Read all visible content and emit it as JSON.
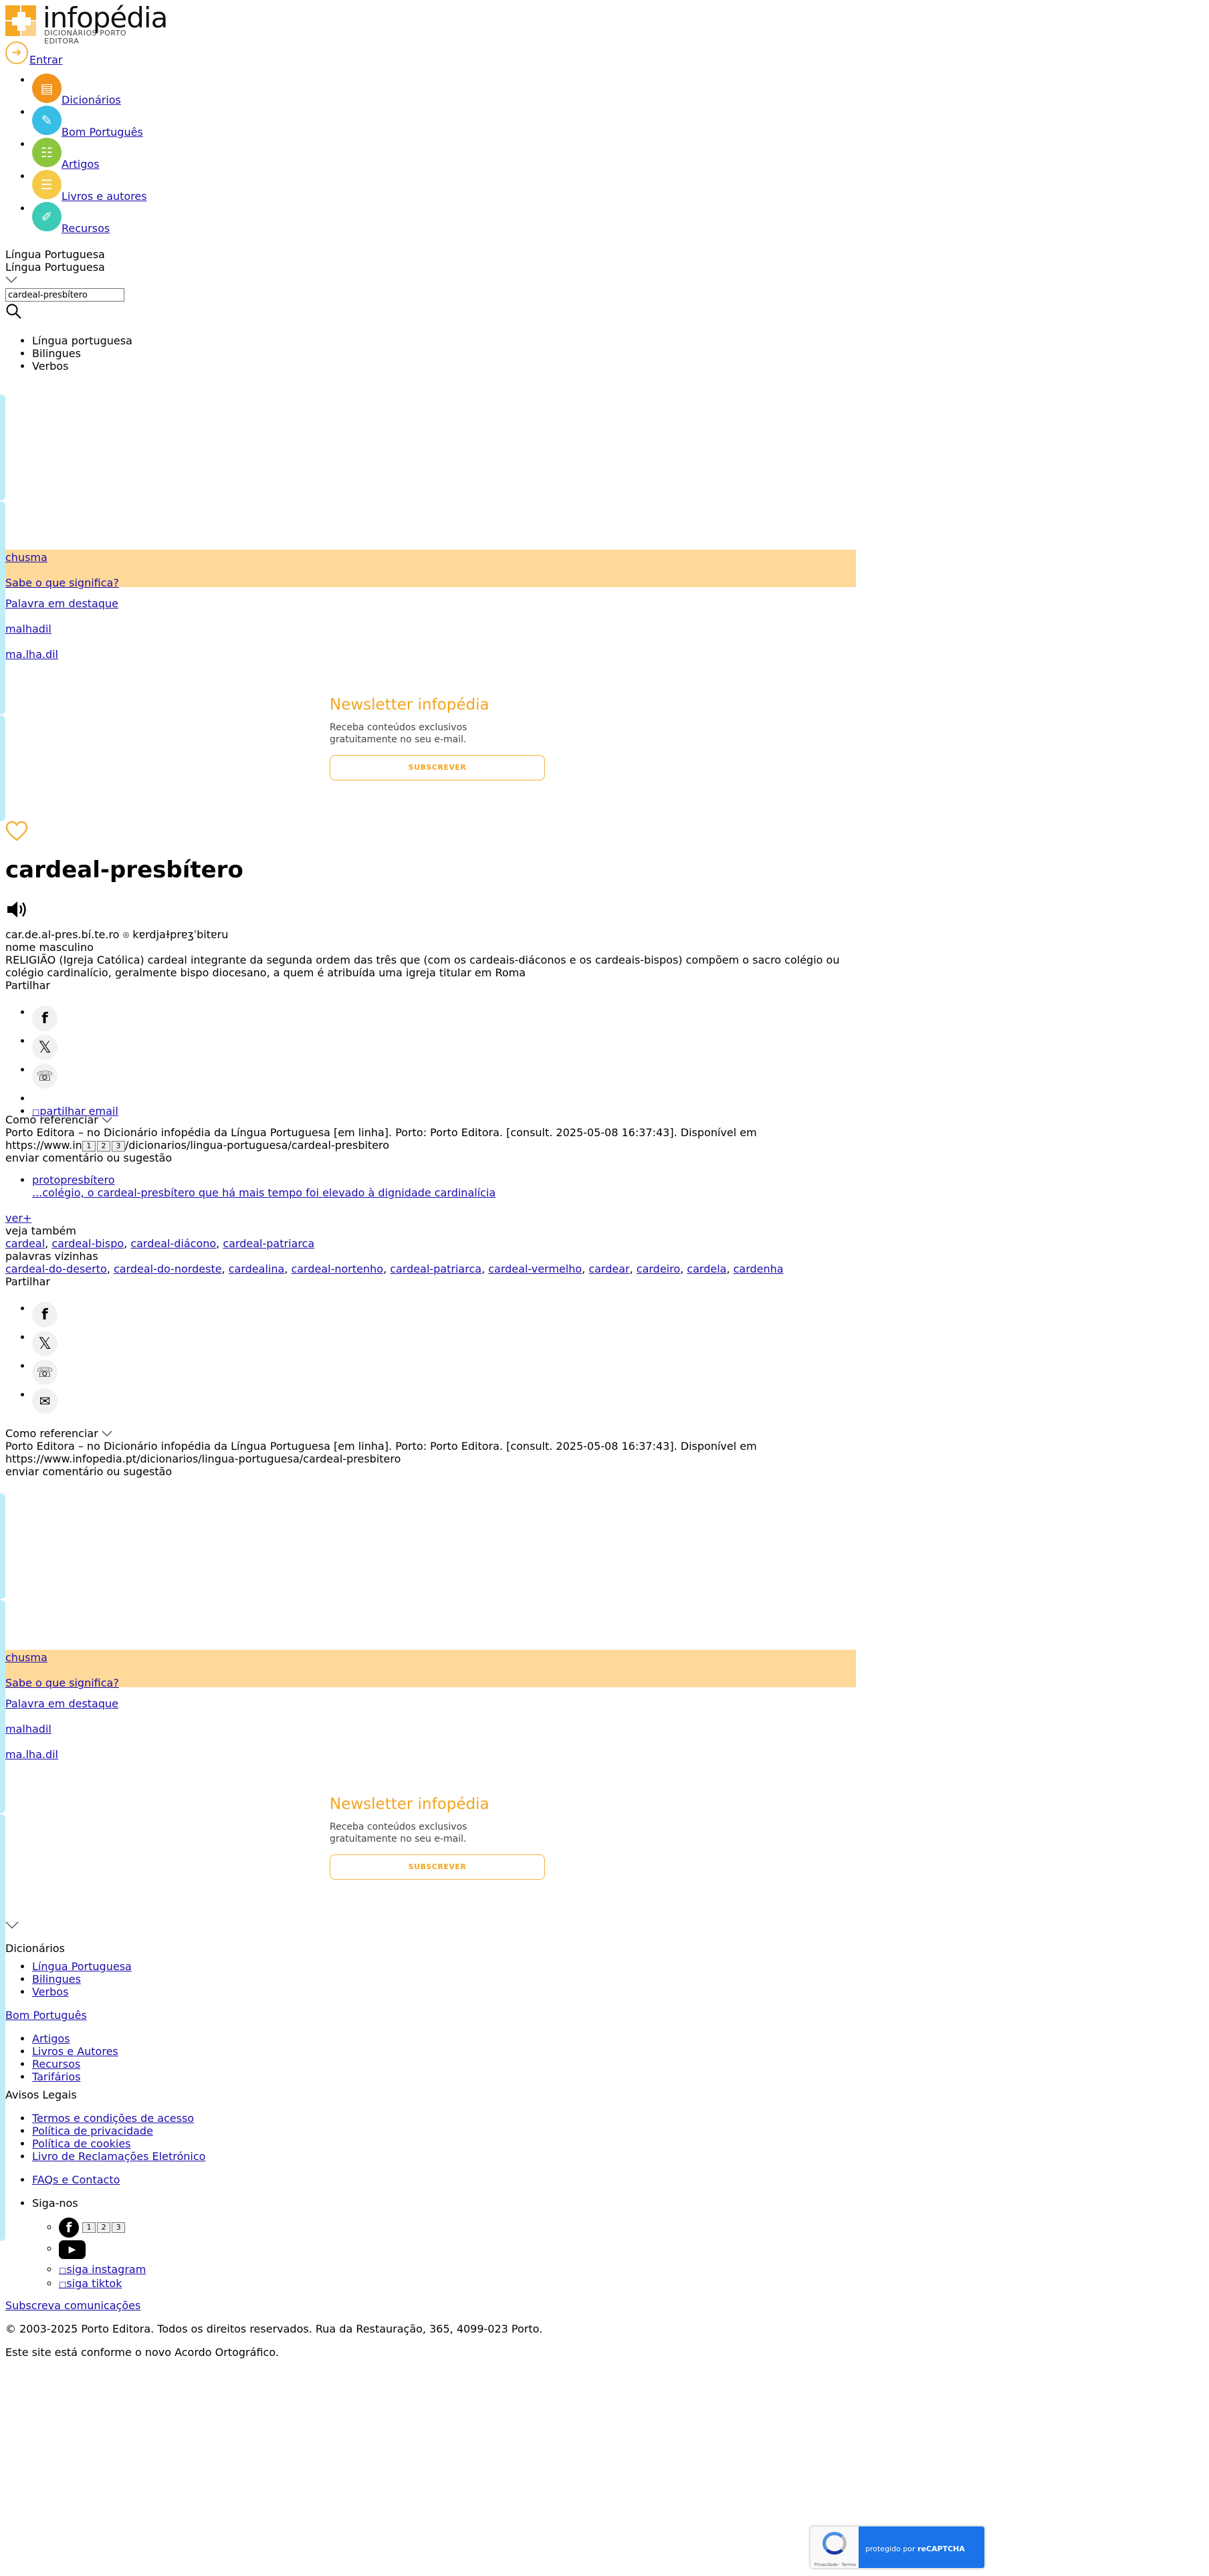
{
  "header": {
    "logo_text": "infopédia",
    "logo_sub": "DICIONÁRIOS PORTO EDITORA",
    "login_label": "Entrar"
  },
  "nav": [
    {
      "label": "Dicionários",
      "color": "#f2931e",
      "icon": "book-icon"
    },
    {
      "label": "Bom Português",
      "color": "#38bde4",
      "icon": "pen-icon"
    },
    {
      "label": "Artigos",
      "color": "#8cc63f",
      "icon": "article-icon"
    },
    {
      "label": "Livros e autores",
      "color": "#f7c948",
      "icon": "books-icon"
    },
    {
      "label": "Recursos",
      "color": "#3ccbb6",
      "icon": "resources-icon"
    }
  ],
  "search": {
    "lang_current": "Língua Portuguesa",
    "lang_selected": "Língua Portuguesa",
    "query": "cardeal-presbítero",
    "options": [
      "Língua portuguesa",
      "Bilingues",
      "Verbos"
    ]
  },
  "sidebar_promo": {
    "word_of_day": "chusma",
    "word_of_day_link": "Sabe o que significa?",
    "featured_label": "Palavra em destaque",
    "featured_word": "malhadil",
    "featured_syllables": "ma.lha.dil",
    "newsletter_title": "Newsletter infopédia",
    "newsletter_text": "Receba conteúdos exclusivos gratuitamente no seu e-mail.",
    "subscribe": "SUBSCREVER"
  },
  "entry": {
    "headword": "cardeal-presbítero",
    "syllables": "car.de.al-pres.bí.te.ro",
    "ipa": "kɐrdjaɫprɐʒˈbitɐru",
    "pos": "nome masculino",
    "definition": "RELIGIÃO (Igreja Católica) cardeal integrante da segunda ordem das três que (com os cardeais-diáconos e os cardeais-bispos) compõem o sacro colégio ou colégio cardinalício, geralmente bispo diocesano, a quem é atribuída uma igreja titular em Roma",
    "share_label": "Partilhar",
    "email_alt": "partilhar email",
    "cite_label": "Como referenciar",
    "cite_text": "Porto Editora – no Dicionário infopédia da Língua Portuguesa [em linha]. Porto: Porto Editora. [consult. 2025-05-08 16:37:43]. Disponível em",
    "cite_url_short": "https://www.in",
    "cite_url_rest": "/dicionarios/lingua-portuguesa/cardeal-presbitero",
    "cite_url": "https://www.infopedia.pt/dicionarios/lingua-portuguesa/cardeal-presbitero",
    "comment": "enviar comentário ou sugestão",
    "example_word": "protopresbítero",
    "example_text": "...colégio, o cardeal-presbítero que há mais tempo foi elevado à dignidade cardinalícia",
    "see_more": "ver+",
    "see_also_label": "veja também",
    "see_also": [
      "cardeal",
      "cardeal-bispo",
      "cardeal-diácono",
      "cardeal-patriarca"
    ],
    "neighbors_label": "palavras vizinhas",
    "neighbors": [
      "cardeal-do-deserto",
      "cardeal-do-nordeste",
      "cardealina",
      "cardeal-nortenho",
      "cardeal-patriarca",
      "cardeal-vermelho",
      "cardear",
      "cardeiro",
      "cardela",
      "cardenha"
    ]
  },
  "footer": {
    "dicionarios": "Dicionários",
    "dic_items": [
      "Língua Portuguesa",
      "Bilingues",
      "Verbos"
    ],
    "bom_portugues": "Bom Português",
    "bp_items": [
      "Artigos",
      "Livros e Autores",
      "Recursos",
      "Tarifários"
    ],
    "avisos": "Avisos Legais",
    "avisos_items": [
      "Termos e condições de acesso",
      "Política de privacidade",
      "Política de cookies",
      "Livro de Reclamações Eletrónico"
    ],
    "faq": "FAQs e Contacto",
    "follow": "Siga-nos",
    "instagram_alt": "siga instagram",
    "tiktok_alt": "siga tiktok",
    "subscribe_comms": "Subscreva comunicações",
    "copyright": "© 2003-2025 Porto Editora. Todos os direitos reservados. Rua da Restauração, 365, 4099-023 Porto.",
    "ortho": "Este site está conforme o novo Acordo Ortográfico."
  },
  "recaptcha": {
    "text_prefix": "protegido por ",
    "text_brand": "reCAPTCHA",
    "small": "Privacidade · Termos"
  },
  "tiny": [
    "1",
    "2",
    "3"
  ]
}
